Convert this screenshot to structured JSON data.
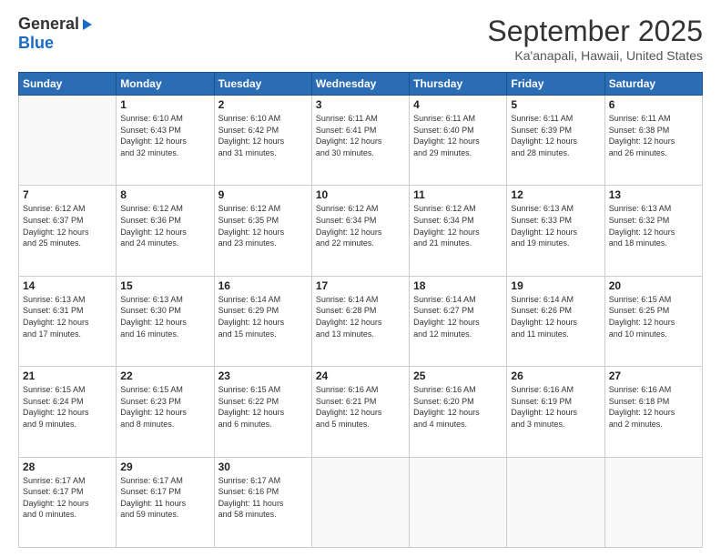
{
  "logo": {
    "general": "General",
    "blue": "Blue"
  },
  "header": {
    "title": "September 2025",
    "subtitle": "Ka'anapali, Hawaii, United States"
  },
  "days": [
    "Sunday",
    "Monday",
    "Tuesday",
    "Wednesday",
    "Thursday",
    "Friday",
    "Saturday"
  ],
  "weeks": [
    [
      {
        "num": "",
        "lines": []
      },
      {
        "num": "1",
        "lines": [
          "Sunrise: 6:10 AM",
          "Sunset: 6:43 PM",
          "Daylight: 12 hours",
          "and 32 minutes."
        ]
      },
      {
        "num": "2",
        "lines": [
          "Sunrise: 6:10 AM",
          "Sunset: 6:42 PM",
          "Daylight: 12 hours",
          "and 31 minutes."
        ]
      },
      {
        "num": "3",
        "lines": [
          "Sunrise: 6:11 AM",
          "Sunset: 6:41 PM",
          "Daylight: 12 hours",
          "and 30 minutes."
        ]
      },
      {
        "num": "4",
        "lines": [
          "Sunrise: 6:11 AM",
          "Sunset: 6:40 PM",
          "Daylight: 12 hours",
          "and 29 minutes."
        ]
      },
      {
        "num": "5",
        "lines": [
          "Sunrise: 6:11 AM",
          "Sunset: 6:39 PM",
          "Daylight: 12 hours",
          "and 28 minutes."
        ]
      },
      {
        "num": "6",
        "lines": [
          "Sunrise: 6:11 AM",
          "Sunset: 6:38 PM",
          "Daylight: 12 hours",
          "and 26 minutes."
        ]
      }
    ],
    [
      {
        "num": "7",
        "lines": [
          "Sunrise: 6:12 AM",
          "Sunset: 6:37 PM",
          "Daylight: 12 hours",
          "and 25 minutes."
        ]
      },
      {
        "num": "8",
        "lines": [
          "Sunrise: 6:12 AM",
          "Sunset: 6:36 PM",
          "Daylight: 12 hours",
          "and 24 minutes."
        ]
      },
      {
        "num": "9",
        "lines": [
          "Sunrise: 6:12 AM",
          "Sunset: 6:35 PM",
          "Daylight: 12 hours",
          "and 23 minutes."
        ]
      },
      {
        "num": "10",
        "lines": [
          "Sunrise: 6:12 AM",
          "Sunset: 6:34 PM",
          "Daylight: 12 hours",
          "and 22 minutes."
        ]
      },
      {
        "num": "11",
        "lines": [
          "Sunrise: 6:12 AM",
          "Sunset: 6:34 PM",
          "Daylight: 12 hours",
          "and 21 minutes."
        ]
      },
      {
        "num": "12",
        "lines": [
          "Sunrise: 6:13 AM",
          "Sunset: 6:33 PM",
          "Daylight: 12 hours",
          "and 19 minutes."
        ]
      },
      {
        "num": "13",
        "lines": [
          "Sunrise: 6:13 AM",
          "Sunset: 6:32 PM",
          "Daylight: 12 hours",
          "and 18 minutes."
        ]
      }
    ],
    [
      {
        "num": "14",
        "lines": [
          "Sunrise: 6:13 AM",
          "Sunset: 6:31 PM",
          "Daylight: 12 hours",
          "and 17 minutes."
        ]
      },
      {
        "num": "15",
        "lines": [
          "Sunrise: 6:13 AM",
          "Sunset: 6:30 PM",
          "Daylight: 12 hours",
          "and 16 minutes."
        ]
      },
      {
        "num": "16",
        "lines": [
          "Sunrise: 6:14 AM",
          "Sunset: 6:29 PM",
          "Daylight: 12 hours",
          "and 15 minutes."
        ]
      },
      {
        "num": "17",
        "lines": [
          "Sunrise: 6:14 AM",
          "Sunset: 6:28 PM",
          "Daylight: 12 hours",
          "and 13 minutes."
        ]
      },
      {
        "num": "18",
        "lines": [
          "Sunrise: 6:14 AM",
          "Sunset: 6:27 PM",
          "Daylight: 12 hours",
          "and 12 minutes."
        ]
      },
      {
        "num": "19",
        "lines": [
          "Sunrise: 6:14 AM",
          "Sunset: 6:26 PM",
          "Daylight: 12 hours",
          "and 11 minutes."
        ]
      },
      {
        "num": "20",
        "lines": [
          "Sunrise: 6:15 AM",
          "Sunset: 6:25 PM",
          "Daylight: 12 hours",
          "and 10 minutes."
        ]
      }
    ],
    [
      {
        "num": "21",
        "lines": [
          "Sunrise: 6:15 AM",
          "Sunset: 6:24 PM",
          "Daylight: 12 hours",
          "and 9 minutes."
        ]
      },
      {
        "num": "22",
        "lines": [
          "Sunrise: 6:15 AM",
          "Sunset: 6:23 PM",
          "Daylight: 12 hours",
          "and 8 minutes."
        ]
      },
      {
        "num": "23",
        "lines": [
          "Sunrise: 6:15 AM",
          "Sunset: 6:22 PM",
          "Daylight: 12 hours",
          "and 6 minutes."
        ]
      },
      {
        "num": "24",
        "lines": [
          "Sunrise: 6:16 AM",
          "Sunset: 6:21 PM",
          "Daylight: 12 hours",
          "and 5 minutes."
        ]
      },
      {
        "num": "25",
        "lines": [
          "Sunrise: 6:16 AM",
          "Sunset: 6:20 PM",
          "Daylight: 12 hours",
          "and 4 minutes."
        ]
      },
      {
        "num": "26",
        "lines": [
          "Sunrise: 6:16 AM",
          "Sunset: 6:19 PM",
          "Daylight: 12 hours",
          "and 3 minutes."
        ]
      },
      {
        "num": "27",
        "lines": [
          "Sunrise: 6:16 AM",
          "Sunset: 6:18 PM",
          "Daylight: 12 hours",
          "and 2 minutes."
        ]
      }
    ],
    [
      {
        "num": "28",
        "lines": [
          "Sunrise: 6:17 AM",
          "Sunset: 6:17 PM",
          "Daylight: 12 hours",
          "and 0 minutes."
        ]
      },
      {
        "num": "29",
        "lines": [
          "Sunrise: 6:17 AM",
          "Sunset: 6:17 PM",
          "Daylight: 11 hours",
          "and 59 minutes."
        ]
      },
      {
        "num": "30",
        "lines": [
          "Sunrise: 6:17 AM",
          "Sunset: 6:16 PM",
          "Daylight: 11 hours",
          "and 58 minutes."
        ]
      },
      {
        "num": "",
        "lines": []
      },
      {
        "num": "",
        "lines": []
      },
      {
        "num": "",
        "lines": []
      },
      {
        "num": "",
        "lines": []
      }
    ]
  ]
}
